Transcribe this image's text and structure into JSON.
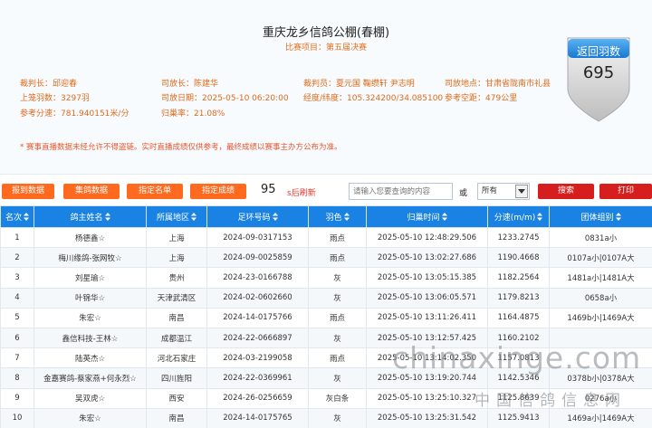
{
  "race": {
    "title": "重庆龙乡信鸽公棚(春棚)",
    "subtitle": "比赛项目：第五届决赛"
  },
  "info": {
    "referee_label": "裁判长：",
    "referee": "邱迎春",
    "loft_manager_label": "司放长：",
    "loft_manager": "陈建华",
    "judges_label": "裁判员：",
    "judges": "夏元国 鞠缵轩 尹志明",
    "release_site_label": "司放地点：",
    "release_site": "甘肃省陇南市礼县",
    "entries_label": "上笼羽数：",
    "entries": "3297羽",
    "release_date_label": "司放日期：",
    "release_date": "2025-05-10 06:20:00",
    "coords_label": "经度/纬度：",
    "coords": "105.324200/34.085100",
    "distance_label": "参考空距：",
    "distance": "479公里",
    "ref_speed_label": "参考分速：",
    "ref_speed": "781.940151米/分",
    "return_rate_label": "归巢率：",
    "return_rate": "21.08%"
  },
  "notice": "* 赛事直播数据未经允许不得盗链。实时直播成绩仅供参考，最终成绩以赛事主办方公布为准。",
  "badge": {
    "label": "返回羽数",
    "count": "695"
  },
  "toolbar": {
    "report_data": "报到数据",
    "collect_data": "集鸽数据",
    "specified_list": "指定名单",
    "specified_results": "指定成绩",
    "refresh_seconds": "95",
    "refresh_text": "s后刷新",
    "search_placeholder": "请输入您要查询的内容",
    "or_text": "或",
    "select_value": "所有",
    "search_button": "搜索",
    "print_button": "打印"
  },
  "table": {
    "headers": [
      "名次",
      "鸽主姓名",
      "所属地区",
      "足环号码",
      "羽色",
      "归巢时间",
      "分速(m/m)",
      "团体组别"
    ],
    "rows": [
      [
        "1",
        "杨德鑫☆",
        "上海",
        "2024-09-0317153",
        "雨点",
        "2025-05-10 12:48:29.506",
        "1233.2745",
        "0831a小"
      ],
      [
        "2",
        "梅川缘鸽-张网牧☆",
        "上海",
        "2024-09-0025859",
        "雨点",
        "2025-05-10 13:02:27.686",
        "1190.4668",
        "0107a小|0107A大"
      ],
      [
        "3",
        "刘星瑜☆",
        "贵州",
        "2024-23-0166788",
        "灰",
        "2025-05-10 13:05:15.385",
        "1182.2564",
        "1481a小|1481A大"
      ],
      [
        "4",
        "叶锦华☆",
        "天津武清区",
        "2024-02-0602660",
        "灰",
        "2025-05-10 13:06:05.571",
        "1179.8213",
        "0658a小"
      ],
      [
        "5",
        "朱宏☆",
        "南昌",
        "2024-14-0175766",
        "雨点",
        "2025-05-10 13:11:26.411",
        "1164.4875",
        "1469b小|1469A大"
      ],
      [
        "6",
        "鑫信科技-王林☆",
        "成都温江",
        "2024-22-0666897",
        "灰",
        "2025-05-10 13:12:57.425",
        "1160.2102",
        ""
      ],
      [
        "7",
        "陆英杰☆",
        "河北石家庄",
        "2024-03-2199058",
        "雨点",
        "2025-05-10 13:14:02.350",
        "1157.0813",
        ""
      ],
      [
        "8",
        "金嘉赛鸽-蔡家燕+何永烈☆",
        "四川旌阳",
        "2024-22-0369961",
        "灰",
        "2025-05-10 13:19:20.744",
        "1142.5346",
        "0378b小|0378A大"
      ],
      [
        "9",
        "吴双虎☆",
        "西安",
        "2024-26-0256659",
        "灰白条",
        "2025-05-10 13:25:10.327",
        "1125.8639",
        "0276a小"
      ],
      [
        "10",
        "朱宏☆",
        "南昌",
        "2024-14-0175765",
        "灰",
        "2025-05-10 13:25:31.542",
        "1125.9413",
        "1469a小|1469A大"
      ]
    ]
  },
  "watermark": {
    "domain": "chinaxinge.com",
    "text": "中国信鸽信息网"
  },
  "colors": {
    "accent_blue": "#1a82e3",
    "orange": "#ff6a1f",
    "red": "#d71e1e",
    "label_orange": "#e06a1a"
  }
}
